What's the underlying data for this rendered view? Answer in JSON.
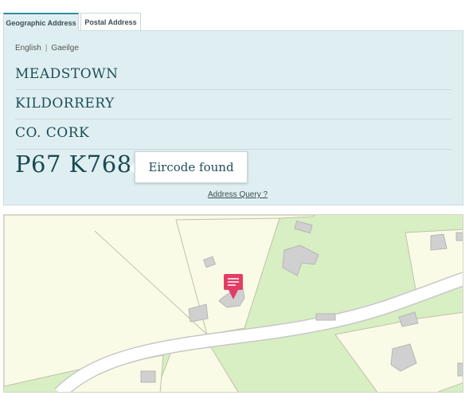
{
  "tabs": {
    "geographic": "Geographic Address",
    "postal": "Postal Address"
  },
  "language": {
    "english": "English",
    "separator": "|",
    "irish": "Gaeilge"
  },
  "address": {
    "line1": "MEADSTOWN",
    "line2": "KILDORRERY",
    "line3": "CO. CORK",
    "eircode": "P67 K768"
  },
  "status": "Eircode found",
  "query_link": "Address Query ?",
  "map": {
    "field_color": "#fafbe6",
    "grass_color": "#d8eec3",
    "road_color": "#ffffff",
    "building_color": "#d0d0d0",
    "marker_color": "#e33d66",
    "marker_icon": "envelope-pin-icon"
  }
}
